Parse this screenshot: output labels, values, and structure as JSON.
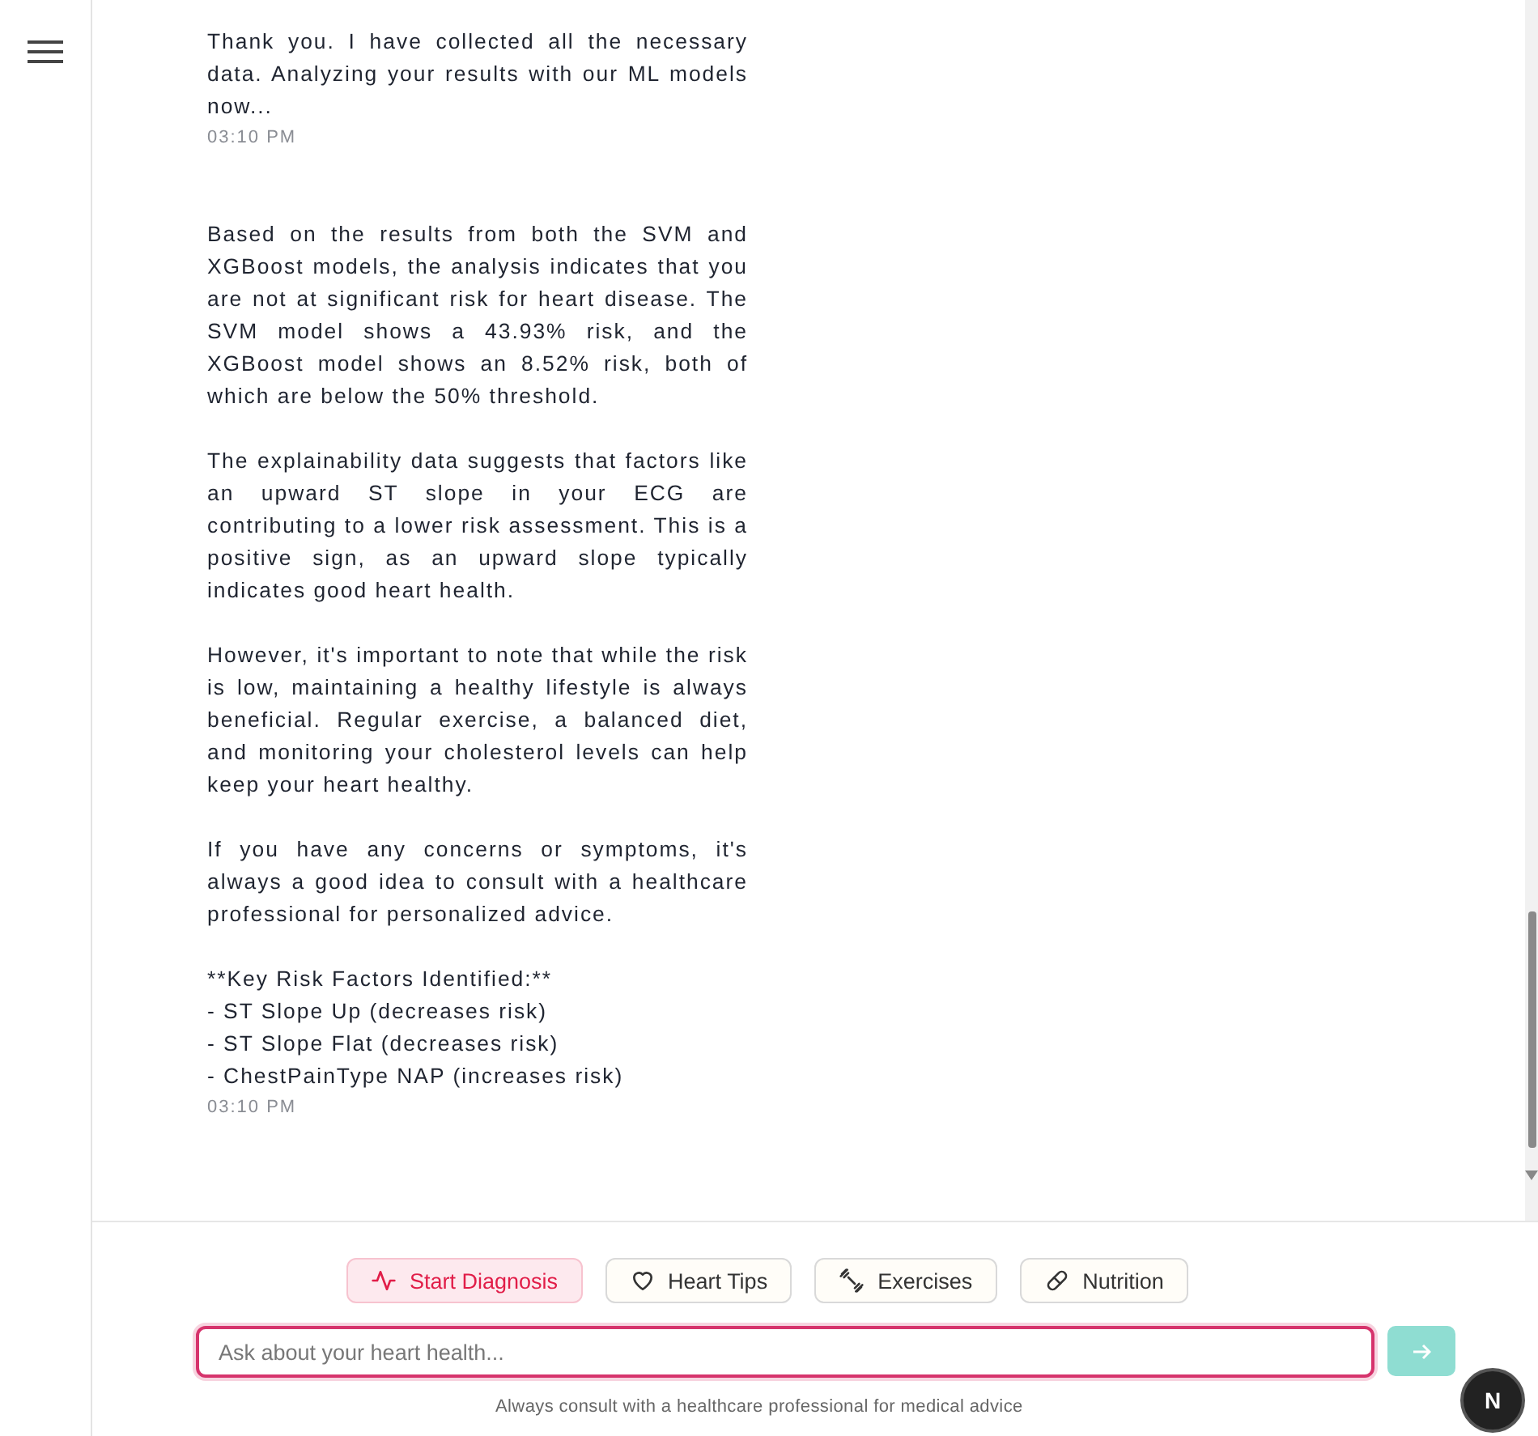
{
  "messages": [
    {
      "paragraphs": [
        {
          "kind": "text",
          "text": "Thank you. I have collected all the necessary data. Analyzing your results with our ML models now..."
        }
      ],
      "time": "03:10 PM"
    },
    {
      "paragraphs": [
        {
          "kind": "text",
          "text": "Based on the results from both the SVM and XGBoost models, the analysis indicates that you are not at significant risk for heart disease. The SVM model shows a 43.93% risk, and the XGBoost model shows an 8.52% risk, both of which are below the 50% threshold."
        },
        {
          "kind": "text",
          "text": "The explainability data suggests that factors like an upward ST slope in your ECG are contributing to a lower risk assessment. This is a positive sign, as an upward slope typically indicates good heart health."
        },
        {
          "kind": "text",
          "text": "However, it's important to note that while the risk is low, maintaining a healthy lifestyle is always beneficial. Regular exercise, a balanced diet, and monitoring your cholesterol levels can help keep your heart healthy."
        },
        {
          "kind": "text",
          "text": "If you have any concerns or symptoms, it's always a good idea to consult with a healthcare professional for personalized advice."
        },
        {
          "kind": "lines",
          "lines": [
            "**Key Risk Factors Identified:**",
            "- ST Slope Up (decreases risk)",
            "- ST Slope Flat (decreases risk)",
            "- ChestPainType NAP (increases risk)"
          ]
        }
      ],
      "time": "03:10 PM"
    }
  ],
  "quick_actions": [
    {
      "kind": "pulse",
      "label": "Start Diagnosis",
      "selected": true
    },
    {
      "kind": "heart",
      "label": "Heart Tips",
      "selected": false
    },
    {
      "kind": "dumbbell",
      "label": "Exercises",
      "selected": false
    },
    {
      "kind": "pill",
      "label": "Nutrition",
      "selected": false
    }
  ],
  "input": {
    "placeholder": "Ask about your heart health..."
  },
  "send_button": {
    "disabled": true
  },
  "disclaimer": "Always consult with a healthcare professional for medical advice",
  "badge": "N"
}
